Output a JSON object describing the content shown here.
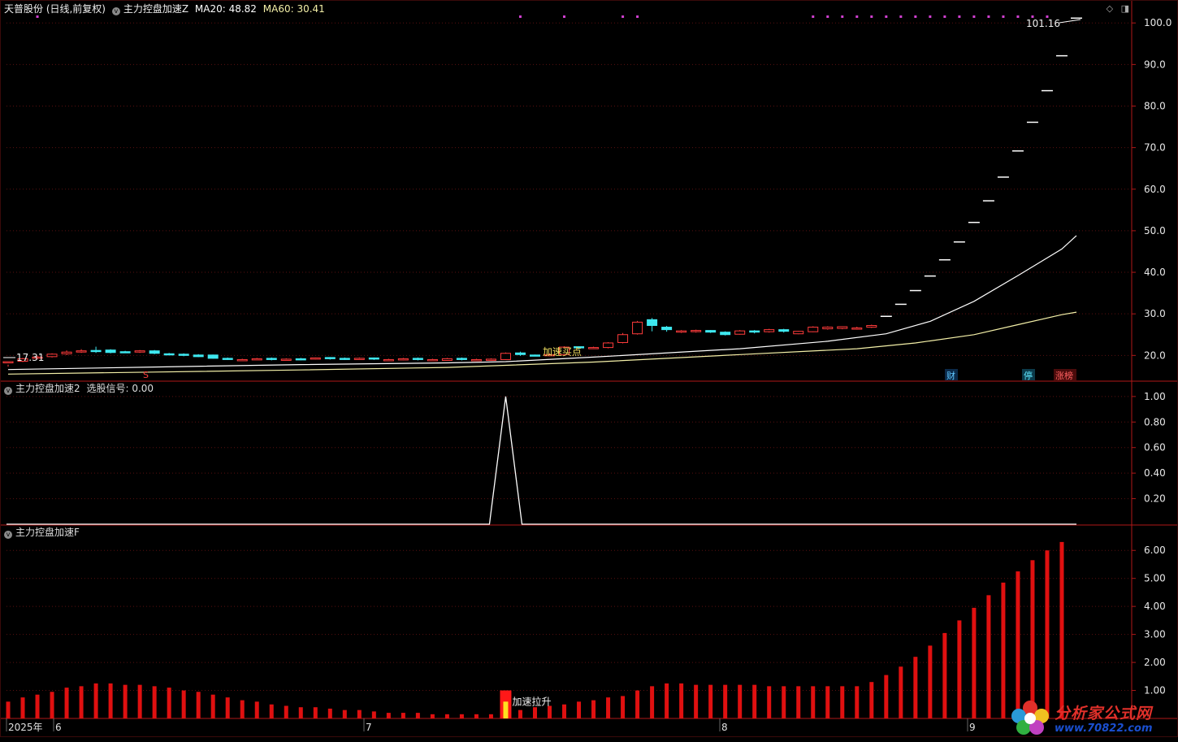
{
  "header": {
    "stock": "天普股份 (日线,前复权)",
    "indicator": "主力控盘加速Z",
    "ma20": "MA20: 48.82",
    "ma60": "MA60: 30.41"
  },
  "panel2": {
    "title": "主力控盘加速2",
    "signal": "选股信号: 0.00"
  },
  "panel3": {
    "title": "主力控盘加速F"
  },
  "icons": [
    "diamond-icon",
    "window-icon"
  ],
  "markers": {
    "price_high": "101.16",
    "price_low": "17.31",
    "buy_text": "加速买点",
    "accel_text": "加速拉升",
    "s_mark": "S",
    "badge_cai": "财",
    "badge_ting": "停",
    "badge_zhangbang": "涨榜"
  },
  "xaxis": {
    "labels": [
      "2025年",
      "6",
      "7",
      "8",
      "9"
    ]
  },
  "logo": {
    "text": "分析家公式网",
    "url": "www.70822.com"
  },
  "colors": {
    "up": "#ff3b3b",
    "down": "#3ee8f0",
    "ma20": "#ffffff",
    "ma60": "#f4f0a8",
    "grid": "#5a1010",
    "axis": "#b01818",
    "bar": "#e01010",
    "magenta": "#d040d0"
  },
  "chart_data": [
    {
      "type": "candlestick",
      "title": "主力控盘加速Z",
      "ylim": [
        14,
        102
      ],
      "yticks": [
        20,
        30,
        40,
        50,
        60,
        70,
        80,
        90,
        100
      ],
      "bars": 70,
      "candles": [
        [
          18.3,
          18.5,
          17.8,
          17.31
        ],
        [
          18.6,
          19.2,
          18.4,
          19.4
        ],
        [
          19.3,
          19.6,
          19.1,
          19.9
        ],
        [
          19.7,
          20.3,
          19.5,
          20.5
        ],
        [
          20.4,
          20.8,
          20.1,
          21.2
        ],
        [
          20.9,
          21.1,
          20.6,
          21.5
        ],
        [
          21.2,
          21.0,
          20.6,
          22.1
        ],
        [
          21.3,
          20.7,
          20.5,
          21.5
        ],
        [
          20.9,
          20.8,
          20.6,
          21.1
        ],
        [
          20.8,
          21.1,
          20.6,
          21.3
        ],
        [
          21.1,
          20.5,
          20.3,
          21.3
        ],
        [
          20.4,
          20.3,
          20.1,
          20.6
        ],
        [
          20.3,
          20.0,
          19.8,
          20.5
        ],
        [
          20.1,
          19.7,
          19.6,
          20.3
        ],
        [
          20.1,
          19.3,
          19.2,
          20.2
        ],
        [
          19.3,
          19.1,
          18.9,
          19.5
        ],
        [
          18.8,
          19.0,
          18.7,
          19.2
        ],
        [
          19.0,
          19.2,
          18.9,
          19.4
        ],
        [
          19.3,
          19.0,
          18.8,
          19.5
        ],
        [
          18.9,
          19.1,
          18.8,
          19.3
        ],
        [
          19.2,
          19.0,
          18.8,
          19.4
        ],
        [
          19.1,
          19.4,
          19.0,
          19.5
        ],
        [
          19.5,
          19.2,
          19.0,
          19.6
        ],
        [
          19.3,
          19.1,
          18.9,
          19.5
        ],
        [
          19.1,
          19.3,
          19.0,
          19.5
        ],
        [
          19.4,
          19.1,
          18.9,
          19.5
        ],
        [
          19.0,
          19.0,
          18.8,
          19.2
        ],
        [
          18.9,
          19.2,
          18.8,
          19.4
        ],
        [
          19.3,
          19.0,
          18.8,
          19.5
        ],
        [
          19.0,
          19.0,
          18.8,
          19.2
        ],
        [
          18.8,
          19.2,
          18.7,
          19.4
        ],
        [
          19.3,
          19.0,
          18.8,
          19.5
        ],
        [
          19.0,
          19.0,
          18.8,
          19.2
        ],
        [
          19.0,
          19.1,
          18.8,
          19.3
        ],
        [
          19.0,
          20.5,
          18.9,
          20.7
        ],
        [
          20.6,
          20.2,
          19.9,
          20.9
        ],
        [
          20.1,
          20.0,
          19.8,
          20.2
        ],
        [
          20.0,
          20.2,
          19.8,
          20.5
        ],
        [
          20.2,
          22.0,
          20.0,
          22.2
        ],
        [
          22.1,
          21.8,
          21.5,
          22.2
        ],
        [
          21.8,
          21.9,
          21.6,
          22.1
        ],
        [
          21.9,
          23.0,
          21.7,
          23.2
        ],
        [
          23.1,
          25.0,
          22.9,
          25.4
        ],
        [
          25.2,
          28.0,
          25.0,
          28.3
        ],
        [
          28.6,
          27.2,
          25.8,
          29.0
        ],
        [
          26.8,
          26.2,
          25.7,
          27.1
        ],
        [
          25.6,
          25.9,
          25.4,
          26.1
        ],
        [
          25.8,
          26.0,
          25.5,
          26.2
        ],
        [
          26.0,
          25.6,
          25.4,
          26.1
        ],
        [
          25.6,
          25.0,
          24.8,
          25.8
        ],
        [
          25.1,
          25.9,
          25.0,
          26.1
        ],
        [
          25.9,
          25.6,
          25.3,
          26.1
        ],
        [
          25.7,
          26.2,
          25.5,
          26.4
        ],
        [
          26.2,
          25.8,
          25.5,
          26.4
        ],
        [
          25.2,
          25.8,
          25.1,
          25.9
        ],
        [
          25.7,
          26.8,
          25.6,
          27.0
        ],
        [
          26.4,
          26.8,
          26.2,
          27.0
        ],
        [
          26.5,
          26.9,
          26.3,
          27.0
        ],
        [
          26.4,
          26.6,
          26.2,
          26.9
        ],
        [
          26.8,
          27.2,
          26.6,
          27.4
        ]
      ],
      "limit_up_bars": [
        [
          60,
          29.4
        ],
        [
          61,
          32.3
        ],
        [
          62,
          35.6
        ],
        [
          63,
          39.1
        ],
        [
          64,
          43.0
        ],
        [
          65,
          47.3
        ],
        [
          66,
          52.0
        ],
        [
          67,
          57.2
        ],
        [
          68,
          62.9
        ],
        [
          69,
          69.2
        ]
      ],
      "extra_up": [
        [
          70,
          76.1
        ],
        [
          71,
          83.7
        ],
        [
          72,
          92.1
        ],
        [
          73,
          101.16
        ]
      ],
      "note_counts": 74,
      "ma20": [
        [
          0,
          16.6
        ],
        [
          10,
          17.2
        ],
        [
          20,
          17.8
        ],
        [
          30,
          18.2
        ],
        [
          34,
          18.5
        ],
        [
          40,
          19.6
        ],
        [
          50,
          21.6
        ],
        [
          56,
          23.4
        ],
        [
          60,
          25.2
        ],
        [
          63,
          28.2
        ],
        [
          66,
          33.0
        ],
        [
          69,
          39.2
        ],
        [
          72,
          45.6
        ],
        [
          73,
          48.82
        ]
      ],
      "ma60": [
        [
          0,
          15.5
        ],
        [
          10,
          16.0
        ],
        [
          20,
          16.5
        ],
        [
          30,
          17.1
        ],
        [
          40,
          18.4
        ],
        [
          50,
          20.2
        ],
        [
          58,
          21.6
        ],
        [
          62,
          23.0
        ],
        [
          66,
          25.0
        ],
        [
          69,
          27.4
        ],
        [
          72,
          29.8
        ],
        [
          73,
          30.41
        ]
      ]
    },
    {
      "type": "line",
      "title": "主力控盘加速2",
      "ylim": [
        0,
        1.05
      ],
      "yticks": [
        0.2,
        0.4,
        0.6,
        0.8,
        1.0
      ],
      "spike_index": 34,
      "values_default": 0,
      "spike_value": 1.0
    },
    {
      "type": "bar",
      "title": "主力控盘加速F",
      "ylim": [
        0,
        6.5
      ],
      "yticks": [
        1.0,
        2.0,
        3.0,
        4.0,
        5.0,
        6.0
      ],
      "values": [
        0.6,
        0.75,
        0.85,
        0.95,
        1.1,
        1.15,
        1.25,
        1.25,
        1.2,
        1.2,
        1.15,
        1.1,
        1.0,
        0.95,
        0.85,
        0.75,
        0.65,
        0.6,
        0.5,
        0.45,
        0.4,
        0.4,
        0.35,
        0.3,
        0.3,
        0.25,
        0.2,
        0.2,
        0.2,
        0.15,
        0.15,
        0.15,
        0.15,
        0.15,
        1.0,
        0.3,
        0.4,
        0.45,
        0.5,
        0.6,
        0.65,
        0.75,
        0.8,
        1.0,
        1.15,
        1.25,
        1.25,
        1.2,
        1.2,
        1.2,
        1.2,
        1.2,
        1.15,
        1.15,
        1.15,
        1.15,
        1.15,
        1.15,
        1.15,
        1.3,
        1.55,
        1.85,
        2.2,
        2.6,
        3.05,
        3.5,
        3.95,
        4.4,
        4.85,
        5.25,
        5.65,
        6.0,
        6.3
      ]
    }
  ]
}
